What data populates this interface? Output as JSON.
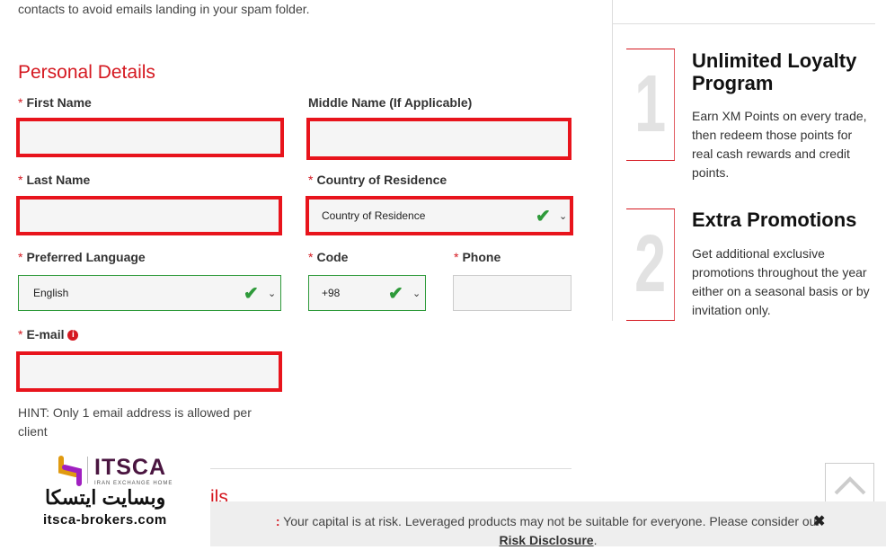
{
  "intro": "contacts to avoid emails landing in your spam folder.",
  "section_title": "Personal Details",
  "section2_title_partial": "ils",
  "form": {
    "required_mark": "*",
    "first_name": {
      "label": "First Name",
      "value": ""
    },
    "middle_name": {
      "label": "Middle Name (If Applicable)",
      "value": ""
    },
    "last_name": {
      "label": "Last Name",
      "value": ""
    },
    "country": {
      "label": "Country of Residence",
      "value": "Country of Residence"
    },
    "language": {
      "label": "Preferred Language",
      "value": "English"
    },
    "code": {
      "label": "Code",
      "value": "+98"
    },
    "phone": {
      "label": "Phone",
      "value": ""
    },
    "email": {
      "label": "E-mail",
      "value": ""
    },
    "hint": "HINT: Only 1 email address is allowed per client"
  },
  "promos": [
    {
      "number": "1",
      "title": "Unlimited Loyalty Program",
      "text": "Earn XM Points on every trade, then redeem those points for real cash rewards and credit points."
    },
    {
      "number": "2",
      "title": "Extra Promotions",
      "text": "Get additional exclusive promotions throughout the year either on a seasonal basis or by invitation only."
    }
  ],
  "risk": {
    "prefix": ":",
    "text": " Your capital is at risk. Leveraged products may not be suitable for everyone. Please consider our",
    "link": "Risk Disclosure",
    "suffix": "."
  },
  "watermark": {
    "brand": "ITSCA",
    "tagline": "IRAN EXCHANGE HOME",
    "persian": "وبسایت ایتسکا",
    "site": "itsca-brokers.com"
  },
  "colors": {
    "accent": "#d51820",
    "error_border": "#e8141c",
    "valid": "#2e9a3a"
  }
}
